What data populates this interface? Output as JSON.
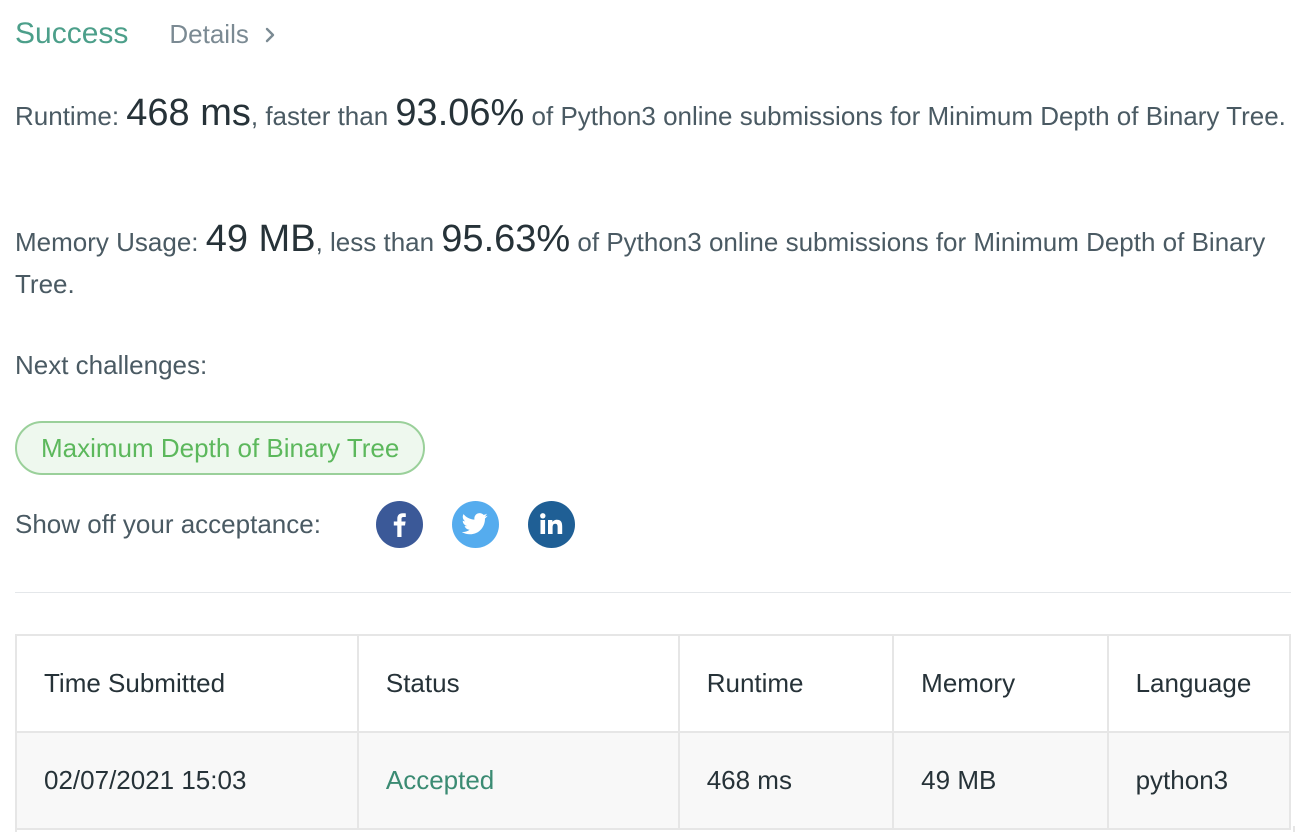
{
  "header": {
    "status": "Success",
    "details_label": "Details"
  },
  "runtime": {
    "label": "Runtime: ",
    "value": "468 ms",
    "comparison": ", faster than ",
    "percent": "93.06%",
    "suffix": " of Python3 online submissions for Minimum Depth of Binary Tree."
  },
  "memory": {
    "label": "Memory Usage: ",
    "value": "49 MB",
    "comparison": ", less than ",
    "percent": "95.63%",
    "suffix": " of Python3 online submissions for Minimum Depth of Binary Tree."
  },
  "next_challenges": {
    "label": "Next challenges:",
    "items": [
      "Maximum Depth of Binary Tree"
    ]
  },
  "share": {
    "label": "Show off your acceptance:",
    "icons": [
      "facebook-icon",
      "twitter-icon",
      "linkedin-icon"
    ]
  },
  "submissions": {
    "columns": [
      "Time Submitted",
      "Status",
      "Runtime",
      "Memory",
      "Language"
    ],
    "rows": [
      {
        "time": "02/07/2021 15:03",
        "status": "Accepted",
        "runtime": "468 ms",
        "memory": "49 MB",
        "language": "python3"
      }
    ]
  },
  "colors": {
    "success": "#4c9f8a",
    "accepted": "#3b8b73",
    "pill_border": "#9ad09a",
    "pill_text": "#5cb85c",
    "facebook": "#3b5998",
    "twitter": "#55acee",
    "linkedin": "#1f5f95"
  }
}
